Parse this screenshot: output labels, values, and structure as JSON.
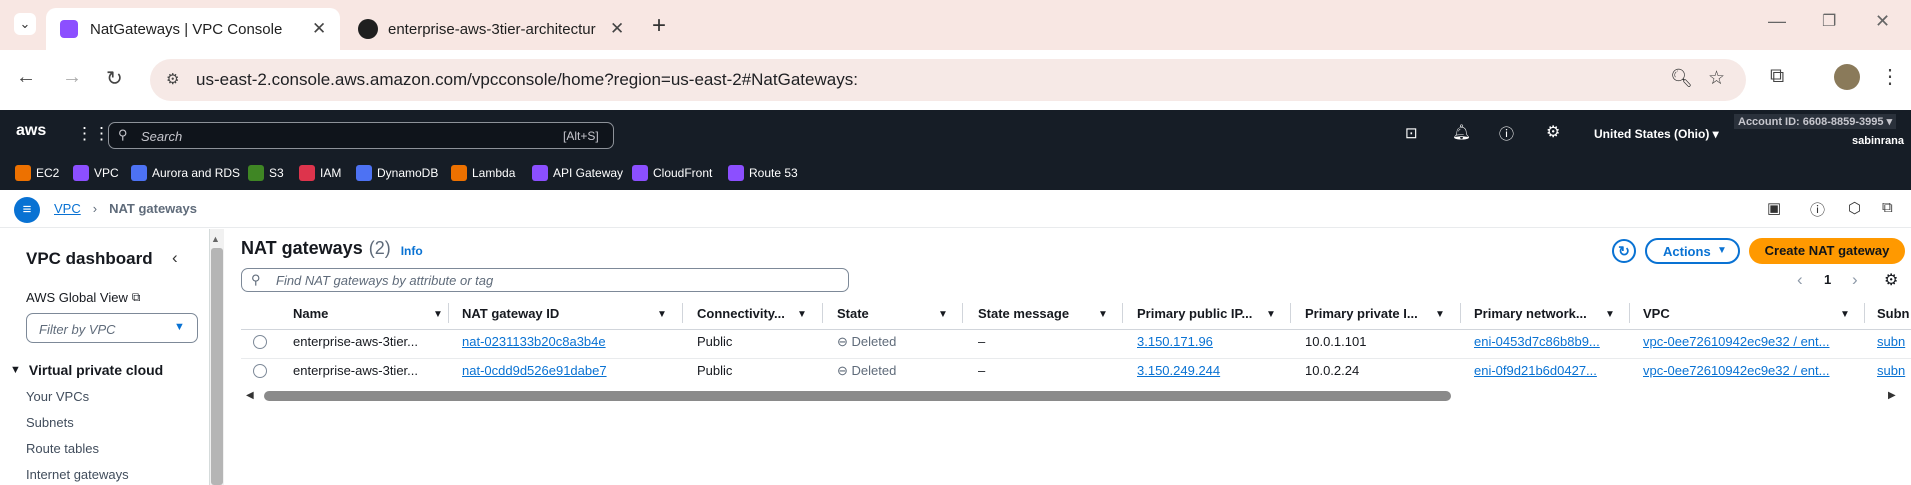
{
  "browser": {
    "tabs": [
      {
        "title": "NatGateways | VPC Console"
      },
      {
        "title": "enterprise-aws-3tier-architectur"
      }
    ],
    "url": "us-east-2.console.aws.amazon.com/vpcconsole/home?region=us-east-2#NatGateways:"
  },
  "aws_header": {
    "logo": "aws",
    "search_placeholder": "Search",
    "search_shortcut": "[Alt+S]",
    "region": "United States (Ohio)",
    "account": "Account ID: 6608-8859-3995",
    "user": "sabinrana"
  },
  "favorites": [
    {
      "label": "EC2",
      "color": "#ed7100"
    },
    {
      "label": "VPC",
      "color": "#8c4fff"
    },
    {
      "label": "Aurora and RDS",
      "color": "#4d72f3"
    },
    {
      "label": "S3",
      "color": "#3f8624"
    },
    {
      "label": "IAM",
      "color": "#dd344c"
    },
    {
      "label": "DynamoDB",
      "color": "#4d72f3"
    },
    {
      "label": "Lambda",
      "color": "#ed7100"
    },
    {
      "label": "API Gateway",
      "color": "#8c4fff"
    },
    {
      "label": "CloudFront",
      "color": "#8c4fff"
    },
    {
      "label": "Route 53",
      "color": "#8c4fff"
    }
  ],
  "breadcrumb": {
    "root": "VPC",
    "current": "NAT gateways"
  },
  "sidebar": {
    "title": "VPC dashboard",
    "global_view": "AWS Global View",
    "filter_placeholder": "Filter by VPC",
    "section": "Virtual private cloud",
    "items": [
      "Your VPCs",
      "Subnets",
      "Route tables",
      "Internet gateways"
    ]
  },
  "main": {
    "title": "NAT gateways",
    "count": "(2)",
    "info": "Info",
    "search_placeholder": "Find NAT gateways by attribute or tag",
    "actions_label": "Actions",
    "create_label": "Create NAT gateway",
    "page": "1",
    "columns": [
      "Name",
      "NAT gateway ID",
      "Connectivity...",
      "State",
      "State message",
      "Primary public IP...",
      "Primary private I...",
      "Primary network...",
      "VPC",
      "Subn"
    ],
    "rows": [
      {
        "name": "enterprise-aws-3tier...",
        "id": "nat-0231133b20c8a3b4e",
        "connectivity": "Public",
        "state": "Deleted",
        "message": "–",
        "public_ip": "3.150.171.96",
        "private_ip": "10.0.1.101",
        "eni": "eni-0453d7c86b8b9...",
        "vpc": "vpc-0ee72610942ec9e32 / ent...",
        "subnet": "subn"
      },
      {
        "name": "enterprise-aws-3tier...",
        "id": "nat-0cdd9d526e91dabe7",
        "connectivity": "Public",
        "state": "Deleted",
        "message": "–",
        "public_ip": "3.150.249.244",
        "private_ip": "10.0.2.24",
        "eni": "eni-0f9d21b6d0427...",
        "vpc": "vpc-0ee72610942ec9e32 / ent...",
        "subnet": "subn"
      }
    ]
  }
}
